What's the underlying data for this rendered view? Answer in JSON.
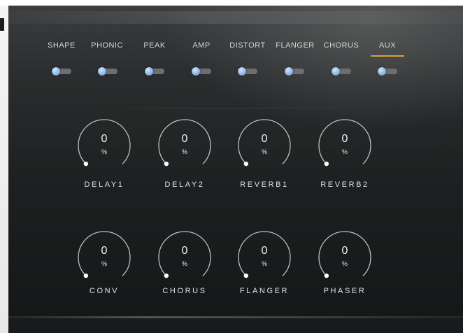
{
  "tabs": [
    {
      "label": "SHAPE",
      "active": false
    },
    {
      "label": "PHONIC",
      "active": false
    },
    {
      "label": "PEAK",
      "active": false
    },
    {
      "label": "AMP",
      "active": false
    },
    {
      "label": "DISTORT",
      "active": false
    },
    {
      "label": "FLANGER",
      "active": false
    },
    {
      "label": "CHORUS",
      "active": false
    },
    {
      "label": "AUX",
      "active": true
    }
  ],
  "toggles": [
    {
      "for": "SHAPE",
      "on": false
    },
    {
      "for": "PHONIC",
      "on": false
    },
    {
      "for": "PEAK",
      "on": false
    },
    {
      "for": "AMP",
      "on": false
    },
    {
      "for": "DISTORT",
      "on": false
    },
    {
      "for": "FLANGER",
      "on": false
    },
    {
      "for": "CHORUS",
      "on": false
    },
    {
      "for": "AUX",
      "on": false
    }
  ],
  "knobs": [
    {
      "label": "DELAY1",
      "value": "0",
      "unit": "%",
      "level": 0
    },
    {
      "label": "DELAY2",
      "value": "0",
      "unit": "%",
      "level": 0
    },
    {
      "label": "REVERB1",
      "value": "0",
      "unit": "%",
      "level": 0
    },
    {
      "label": "REVERB2",
      "value": "0",
      "unit": "%",
      "level": 0
    },
    {
      "label": "CONV",
      "value": "0",
      "unit": "%",
      "level": 0
    },
    {
      "label": "CHORUS",
      "value": "0",
      "unit": "%",
      "level": 0
    },
    {
      "label": "FLANGER",
      "value": "0",
      "unit": "%",
      "level": 0
    },
    {
      "label": "PHASER",
      "value": "0",
      "unit": "%",
      "level": 0
    }
  ],
  "colors": {
    "accent_underline": "#d8a23a",
    "toggle_thumb": "#8fb6e4",
    "toggle_track": "#6c6e70",
    "knob_arc": "#bdbfc0",
    "knob_indicator": "#ffffff"
  }
}
